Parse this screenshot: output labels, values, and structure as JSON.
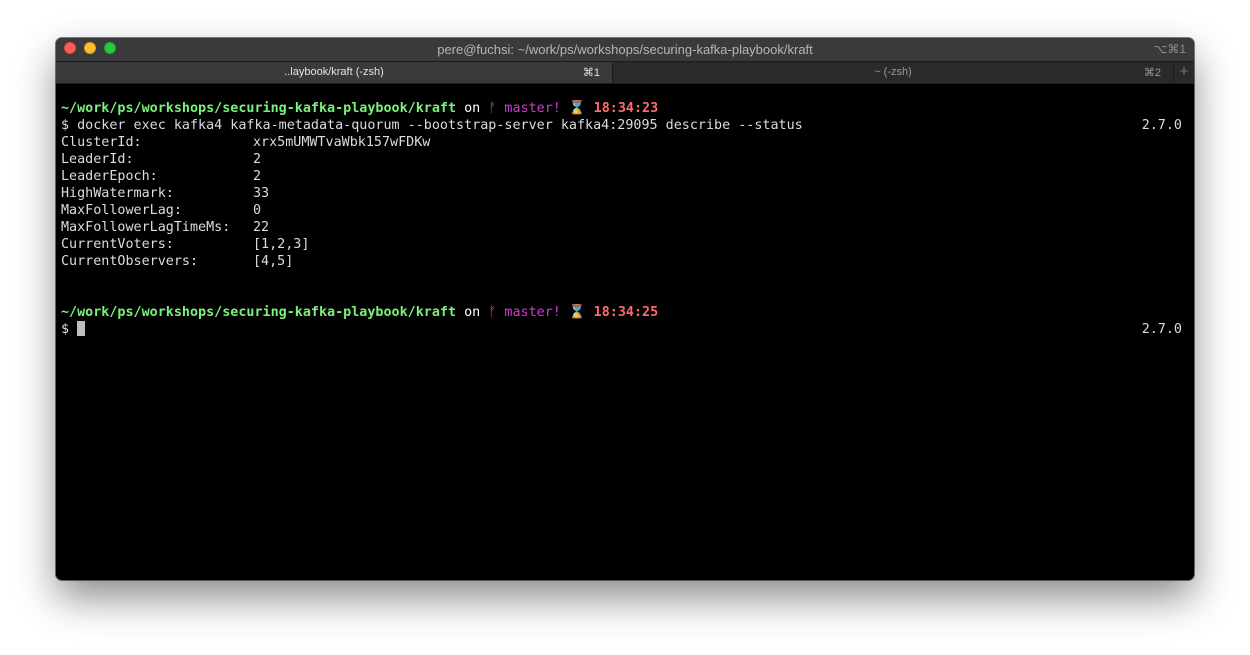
{
  "window": {
    "title": "pere@fuchsi: ~/work/ps/workshops/securing-kafka-playbook/kraft",
    "shortcut": "⌥⌘1"
  },
  "tabs": [
    {
      "label": "..laybook/kraft (-zsh)",
      "shortcut": "⌘1",
      "active": true
    },
    {
      "label": "~ (-zsh)",
      "shortcut": "⌘2",
      "active": false
    }
  ],
  "tab_add": "+",
  "prompt1": {
    "path": "~/work/ps/workshops/securing-kafka-playbook/kraft",
    "on": "on",
    "branch_icon": "ᚠ",
    "branch": "master!",
    "clock_icon": "⌛",
    "time": "18:34:23"
  },
  "command": {
    "text": "$ docker exec kafka4 kafka-metadata-quorum --bootstrap-server kafka4:29095 describe --status",
    "version": "2.7.0"
  },
  "output": [
    {
      "key": "ClusterId:",
      "value": "xrx5mUMWTvaWbk157wFDKw"
    },
    {
      "key": "LeaderId:",
      "value": "2"
    },
    {
      "key": "LeaderEpoch:",
      "value": "2"
    },
    {
      "key": "HighWatermark:",
      "value": "33"
    },
    {
      "key": "MaxFollowerLag:",
      "value": "0"
    },
    {
      "key": "MaxFollowerLagTimeMs:",
      "value": "22"
    },
    {
      "key": "CurrentVoters:",
      "value": "[1,2,3]"
    },
    {
      "key": "CurrentObservers:",
      "value": "[4,5]"
    }
  ],
  "prompt2": {
    "path": "~/work/ps/workshops/securing-kafka-playbook/kraft",
    "on": "on",
    "branch_icon": "ᚠ",
    "branch": "master!",
    "clock_icon": "⌛",
    "time": "18:34:25"
  },
  "input_line": {
    "prompt": "$ ",
    "version": "2.7.0"
  }
}
